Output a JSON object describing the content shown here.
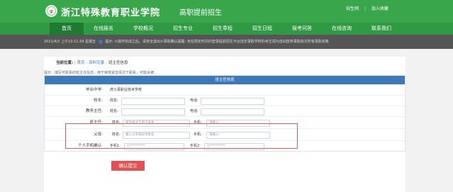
{
  "header": {
    "school_name": "浙江特殊教育职业学院",
    "subtitle": "高职提前招生",
    "links": [
      "招生网",
      "加入收藏"
    ]
  },
  "nav": {
    "items": [
      "首页",
      "在线报名",
      "学校概况",
      "招生专业",
      "招生章程",
      "招生日程",
      "报考问答",
      "在线咨询",
      "联系我们"
    ],
    "active_index": 0
  },
  "notice": {
    "date": "2021/4/2 上午10:11:34 星期五",
    "text": "提示: ①操作完成之后，请安全退出②录取确认提醒: 未在规定时间内登录提前招生平台选定录取学校的考生视为自动放弃录取批次所有录取资格"
  },
  "breadcrumb": {
    "label": "当前位置:",
    "home": "首页",
    "section": "资料完善",
    "current": "班主任信息"
  },
  "hint": "提示：填写可联系的班主任信息，用于审核紧急情况下联系，可能会被...",
  "table": {
    "title": "班主任信息",
    "school_label": "毕业中学:",
    "school_value": "虎义县职业技术学校",
    "principal_label": "校长:",
    "teacher_label": "教务主任:",
    "homeroom_label": "班主任:",
    "parent_label": "父母:",
    "phone_confirm_label": "个人手机确认:",
    "name_sub": "姓名:",
    "tel_sub": "电话:",
    "mobile_sub": "手机:",
    "mobile1_sub": "手机1:",
    "mobile2_sub": "手机2:",
    "homeroom_name_placeholder": "紧急情况下用于联系",
    "homeroom_phone_placeholder": "请输入",
    "parent_name_placeholder": "输入父亲或母亲姓名",
    "parent_phone_placeholder": "请输入",
    "mobile1_value": "1**********",
    "mobile2_value": "1**********"
  },
  "submit_label": "确认提交"
}
